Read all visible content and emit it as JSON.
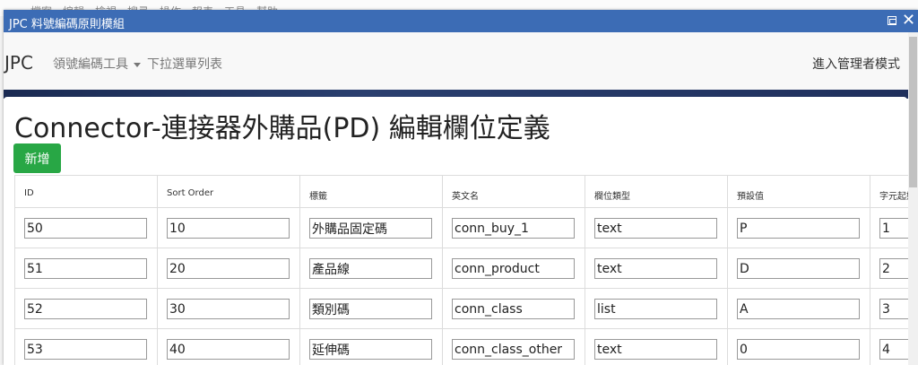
{
  "background_menu": [
    "檔案",
    "編輯",
    "檢視",
    "搜尋",
    "操作",
    "報表",
    "工具",
    "幫助"
  ],
  "dialog": {
    "title": "JPC 料號編碼原則模組"
  },
  "navbar": {
    "brand": "JPC",
    "menu_encode_tools": "領號編碼工具",
    "menu_dropdown_list": "下拉選單列表",
    "admin_mode": "進入管理者模式"
  },
  "page": {
    "title": "Connector-連接器外購品(PD) 編輯欄位定義",
    "add_button": "新增"
  },
  "table": {
    "headers": [
      "ID",
      "Sort Order",
      "標籤",
      "英文名",
      "欄位類型",
      "預設值",
      "字元起始"
    ],
    "rows": [
      [
        "50",
        "10",
        "外購品固定碼",
        "conn_buy_1",
        "text",
        "P",
        "1"
      ],
      [
        "51",
        "20",
        "產品線",
        "conn_product",
        "text",
        "D",
        "2"
      ],
      [
        "52",
        "30",
        "類別碼",
        "conn_class",
        "list",
        "A",
        "3"
      ],
      [
        "53",
        "40",
        "延伸碼",
        "conn_class_other",
        "text",
        "0",
        "4"
      ]
    ]
  }
}
